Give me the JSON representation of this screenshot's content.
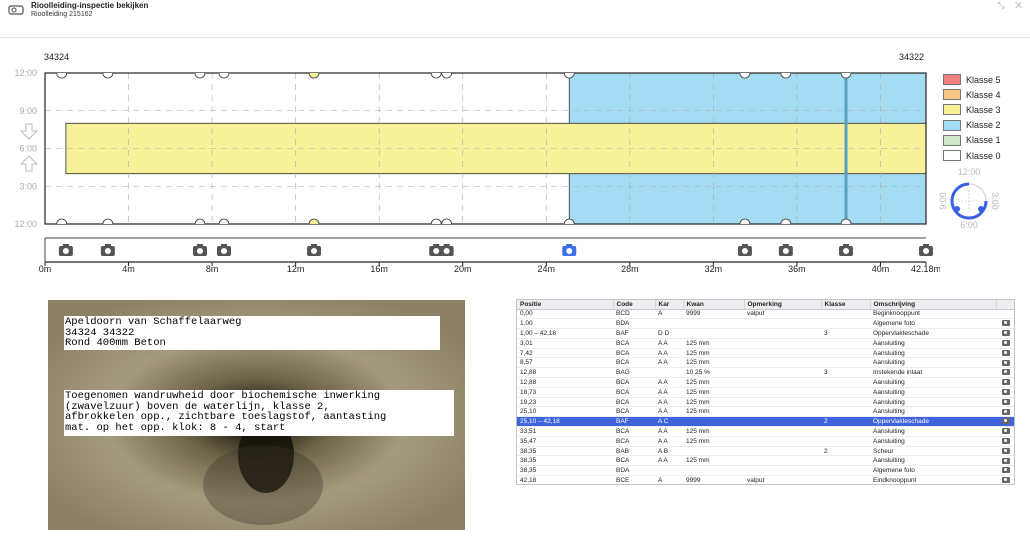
{
  "window": {
    "title": "Rioolleiding-inspectie bekijken",
    "subtitle": "Rioolleiding 215162",
    "controls": "⤡ ✕"
  },
  "nodes": {
    "start": "34324",
    "end": "34322"
  },
  "chart_data": {
    "type": "bar",
    "x_unit": "m",
    "x_ticks": [
      "0m",
      "4m",
      "8m",
      "12m",
      "16m",
      "20m",
      "24m",
      "28m",
      "32m",
      "36m",
      "40m",
      "42.18m"
    ],
    "x_tick_values": [
      0,
      4,
      8,
      12,
      16,
      20,
      24,
      28,
      32,
      36,
      40,
      42.18
    ],
    "y_ticks": [
      "12:00",
      "9:00",
      "6:00",
      "3:00",
      "12:00"
    ],
    "xlim": [
      0,
      42.18
    ],
    "segments": [
      {
        "from": 1.0,
        "to": 42.18,
        "clock_from": 4,
        "clock_to": 8,
        "class": "Klasse 3"
      },
      {
        "from": 25.1,
        "to": 42.18,
        "clock_from": 0,
        "clock_to": 12,
        "class": "Klasse 2"
      }
    ],
    "connections_top_and_bottom": [
      0.8,
      3.01,
      7.42,
      8.57,
      12.88,
      18.73,
      19.23,
      25.1,
      33.51,
      35.47,
      38.35
    ],
    "connections_class3": [
      12.88
    ],
    "photos": [
      1.0,
      3.01,
      7.42,
      8.57,
      12.88,
      18.73,
      19.23,
      25.1,
      33.51,
      35.47,
      38.35,
      42.18
    ],
    "photo_selected": 25.1
  },
  "legend": [
    {
      "label": "Klasse 5",
      "color": "#f47f7f"
    },
    {
      "label": "Klasse 4",
      "color": "#f7c680"
    },
    {
      "label": "Klasse 3",
      "color": "#f7f29a"
    },
    {
      "label": "Klasse 2",
      "color": "#a3dcf3"
    },
    {
      "label": "Klasse 1",
      "color": "#cfe9c8"
    },
    {
      "label": "Klasse 0",
      "color": "#ffffff"
    }
  ],
  "clock_dial": {
    "top": "12:00",
    "right": "3:00",
    "bottom": "6:00",
    "left": "9:00"
  },
  "video": {
    "overlay_top": "Apeldoorn van Schaffelaarweg\n34324 34322\nRond 400mm Beton",
    "overlay_desc": "Toegenomen wandruwheid door biochemische inwerking\n(zwavelzuur) boven de waterlijn, klasse 2,\nafbrokkelen opp., zichtbare toeslagstof, aantasting\nmat. op het opp. klok: 8 - 4, start"
  },
  "table": {
    "columns": [
      "Positie",
      "Code",
      "Kar",
      "Kwan",
      "Opmerking",
      "Klasse",
      "Omschrijving",
      ""
    ],
    "rows": [
      [
        "0,00",
        "BCD",
        "A",
        "9999",
        "valput",
        "",
        "Beginknooppunt",
        ""
      ],
      [
        "1,00",
        "BDA",
        "",
        "",
        "",
        "",
        "Algemene foto",
        "cam"
      ],
      [
        "1,00 – 42,18",
        "BAF",
        "D D",
        "",
        "",
        "3",
        "Oppervlakteschade",
        "cam"
      ],
      [
        "3,01",
        "BCA",
        "A A",
        "125 mm",
        "",
        "",
        "Aansluiting",
        "cam"
      ],
      [
        "7,42",
        "BCA",
        "A A",
        "125 mm",
        "",
        "",
        "Aansluiting",
        "cam"
      ],
      [
        "8,57",
        "BCA",
        "A A",
        "125 mm",
        "",
        "",
        "Aansluiting",
        "cam"
      ],
      [
        "12,88",
        "BAG",
        "",
        "10 25 %",
        "",
        "3",
        "Instekende inlaat",
        "cam"
      ],
      [
        "12,88",
        "BCA",
        "A A",
        "125 mm",
        "",
        "",
        "Aansluiting",
        "cam"
      ],
      [
        "18,73",
        "BCA",
        "A A",
        "125 mm",
        "",
        "",
        "Aansluiting",
        "cam"
      ],
      [
        "19,23",
        "BCA",
        "A A",
        "125 mm",
        "",
        "",
        "Aansluiting",
        "cam"
      ],
      [
        "25,10",
        "BCA",
        "A A",
        "125 mm",
        "",
        "",
        "Aansluiting",
        "cam"
      ],
      [
        "25,10 – 42,18",
        "BAF",
        "A C",
        "",
        "",
        "2",
        "Oppervlakteschade",
        "cam"
      ],
      [
        "33,51",
        "BCA",
        "A A",
        "125 mm",
        "",
        "",
        "Aansluiting",
        "cam"
      ],
      [
        "35,47",
        "BCA",
        "A A",
        "125 mm",
        "",
        "",
        "Aansluiting",
        "cam"
      ],
      [
        "38,35",
        "BAB",
        "A B",
        "",
        "",
        "2",
        "Scheur",
        "cam"
      ],
      [
        "38,35",
        "BCA",
        "A A",
        "125 mm",
        "",
        "",
        "Aansluiting",
        "cam"
      ],
      [
        "38,35",
        "BDA",
        "",
        "",
        "",
        "",
        "Algemene foto",
        "cam"
      ],
      [
        "42,18",
        "BCE",
        "A",
        "9999",
        "valput",
        "",
        "Eindknooppunt",
        "cam"
      ]
    ],
    "selected_row": 11
  }
}
